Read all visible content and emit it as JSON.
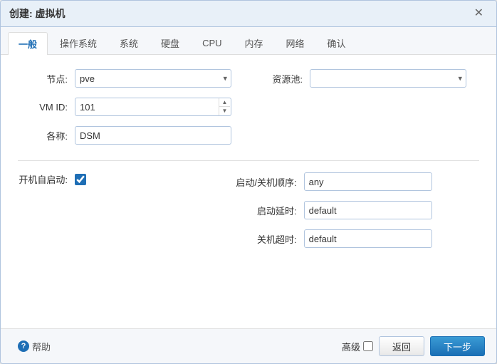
{
  "dialog": {
    "title": "创建: 虚拟机",
    "close_label": "✕"
  },
  "tabs": [
    {
      "id": "general",
      "label": "一般",
      "active": true
    },
    {
      "id": "os",
      "label": "操作系统",
      "active": false
    },
    {
      "id": "system",
      "label": "系统",
      "active": false
    },
    {
      "id": "disk",
      "label": "硬盘",
      "active": false
    },
    {
      "id": "cpu",
      "label": "CPU",
      "active": false
    },
    {
      "id": "memory",
      "label": "内存",
      "active": false
    },
    {
      "id": "network",
      "label": "网络",
      "active": false
    },
    {
      "id": "confirm",
      "label": "确认",
      "active": false
    }
  ],
  "form": {
    "node_label": "节点:",
    "node_value": "pve",
    "vmid_label": "VM ID:",
    "vmid_value": "101",
    "name_label": "各称:",
    "name_value": "DSM",
    "resource_pool_label": "资源池:",
    "autostart_label": "开机自启动:",
    "startup_order_label": "启动/关机顺序:",
    "startup_order_value": "any",
    "startup_delay_label": "启动延时:",
    "startup_delay_value": "default",
    "shutdown_timeout_label": "关机超时:",
    "shutdown_timeout_value": "default"
  },
  "footer": {
    "help_label": "帮助",
    "advanced_label": "高级",
    "back_label": "返回",
    "next_label": "下一步"
  }
}
